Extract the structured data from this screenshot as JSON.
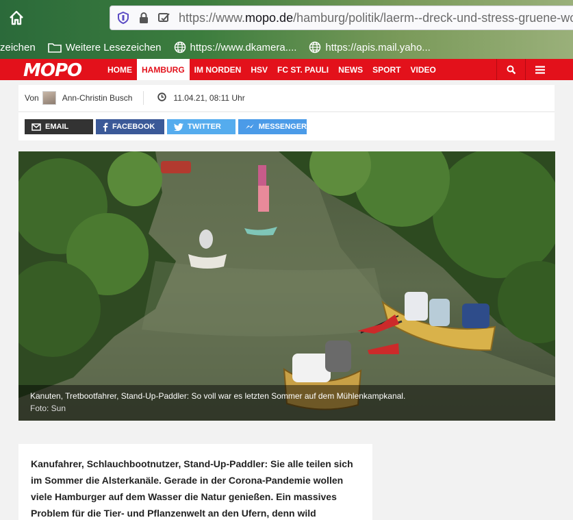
{
  "browser": {
    "url_prefix": "https://www.",
    "url_domain": "mopo.de",
    "url_path": "/hamburg/politik/laerm--dreck-und-stress-gruene-wo",
    "bookmarks": [
      {
        "label": "zeichen",
        "icon": "none"
      },
      {
        "label": "Weitere Lesezeichen",
        "icon": "folder-icon"
      },
      {
        "label": "https://www.dkamera....",
        "icon": "globe-icon"
      },
      {
        "label": "https://apis.mail.yaho...",
        "icon": "globe-icon"
      }
    ]
  },
  "nav": {
    "logo": "MOPO",
    "items": [
      "HOME",
      "HAMBURG",
      "IM NORDEN",
      "HSV",
      "FC ST. PAULI",
      "NEWS",
      "SPORT",
      "VIDEO"
    ],
    "active_index": 1
  },
  "meta": {
    "von": "Von",
    "author": "Ann-Christin Busch",
    "date": "11.04.21, 08:11 Uhr"
  },
  "share": {
    "email": "EMAIL",
    "facebook": "FACEBOOK",
    "twitter": "TWITTER",
    "messenger": "MESSENGER"
  },
  "photo": {
    "caption": "Kanuten, Tretbootfahrer, Stand-Up-Paddler: So voll war es letzten Sommer auf dem Mühlenkampkanal.",
    "credit": "Foto: Sun"
  },
  "article": {
    "lead": "Kanufahrer, Schlauchbootnutzer, Stand-Up-Paddler: Sie alle teilen sich im Sommer die Alsterkanäle. Gerade in der Corona-Pandemie wollen viele Hamburger auf dem Wasser die Natur genießen. Ein massives Problem für die Tier- und Pflanzenwelt an den Ufern, denn wild"
  },
  "colors": {
    "brand_red": "#e3111b",
    "email": "#333333",
    "facebook": "#3b5998",
    "twitter": "#55acee",
    "messenger": "#4b9be8"
  }
}
